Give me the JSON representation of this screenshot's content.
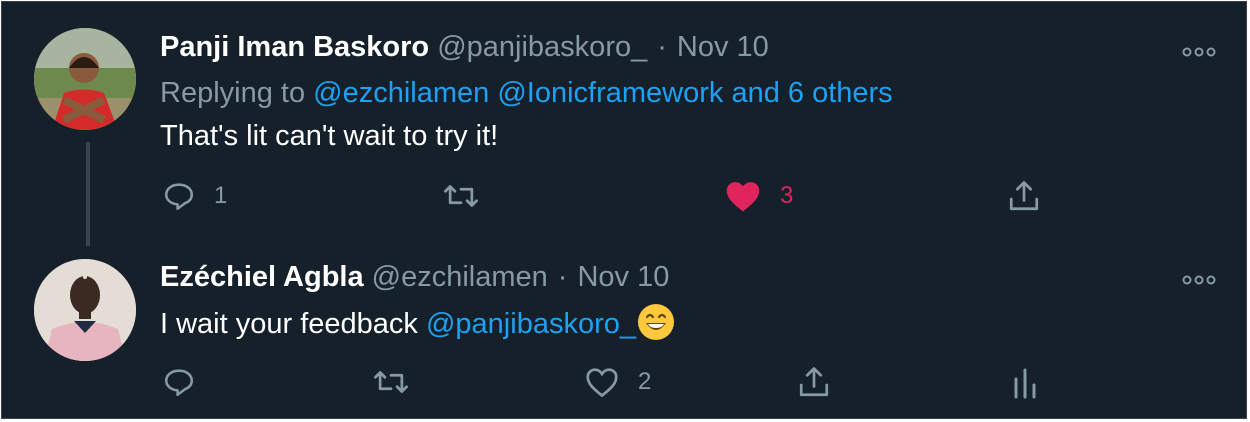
{
  "tweets": [
    {
      "name": "Panji Iman Baskoro",
      "handle": "@panjibaskoro_",
      "date": "Nov 10",
      "replying_prefix": "Replying to ",
      "replying_links": "@ezchilamen @Ionicframework and 6 others",
      "text": "That's lit can't wait to try it!",
      "reply_count": "1",
      "like_count": "3",
      "liked": true,
      "colors": {
        "like_active": "#e0245e",
        "link": "#1da1f2"
      }
    },
    {
      "name": "Ezéchiel Agbla",
      "handle": "@ezchilamen",
      "date": "Nov 10",
      "text_prefix": "I wait your feedback ",
      "mention": "@panjibaskoro_",
      "emoji": "grinning-face-emoji",
      "like_count": "2",
      "liked": false
    }
  ],
  "theme": {
    "background": "#15202b",
    "muted": "#8899a6",
    "text": "#ffffff",
    "divider": "#38444d"
  },
  "icons": [
    "reply-icon",
    "retweet-icon",
    "like-icon",
    "share-icon",
    "analytics-icon",
    "more-icon"
  ]
}
